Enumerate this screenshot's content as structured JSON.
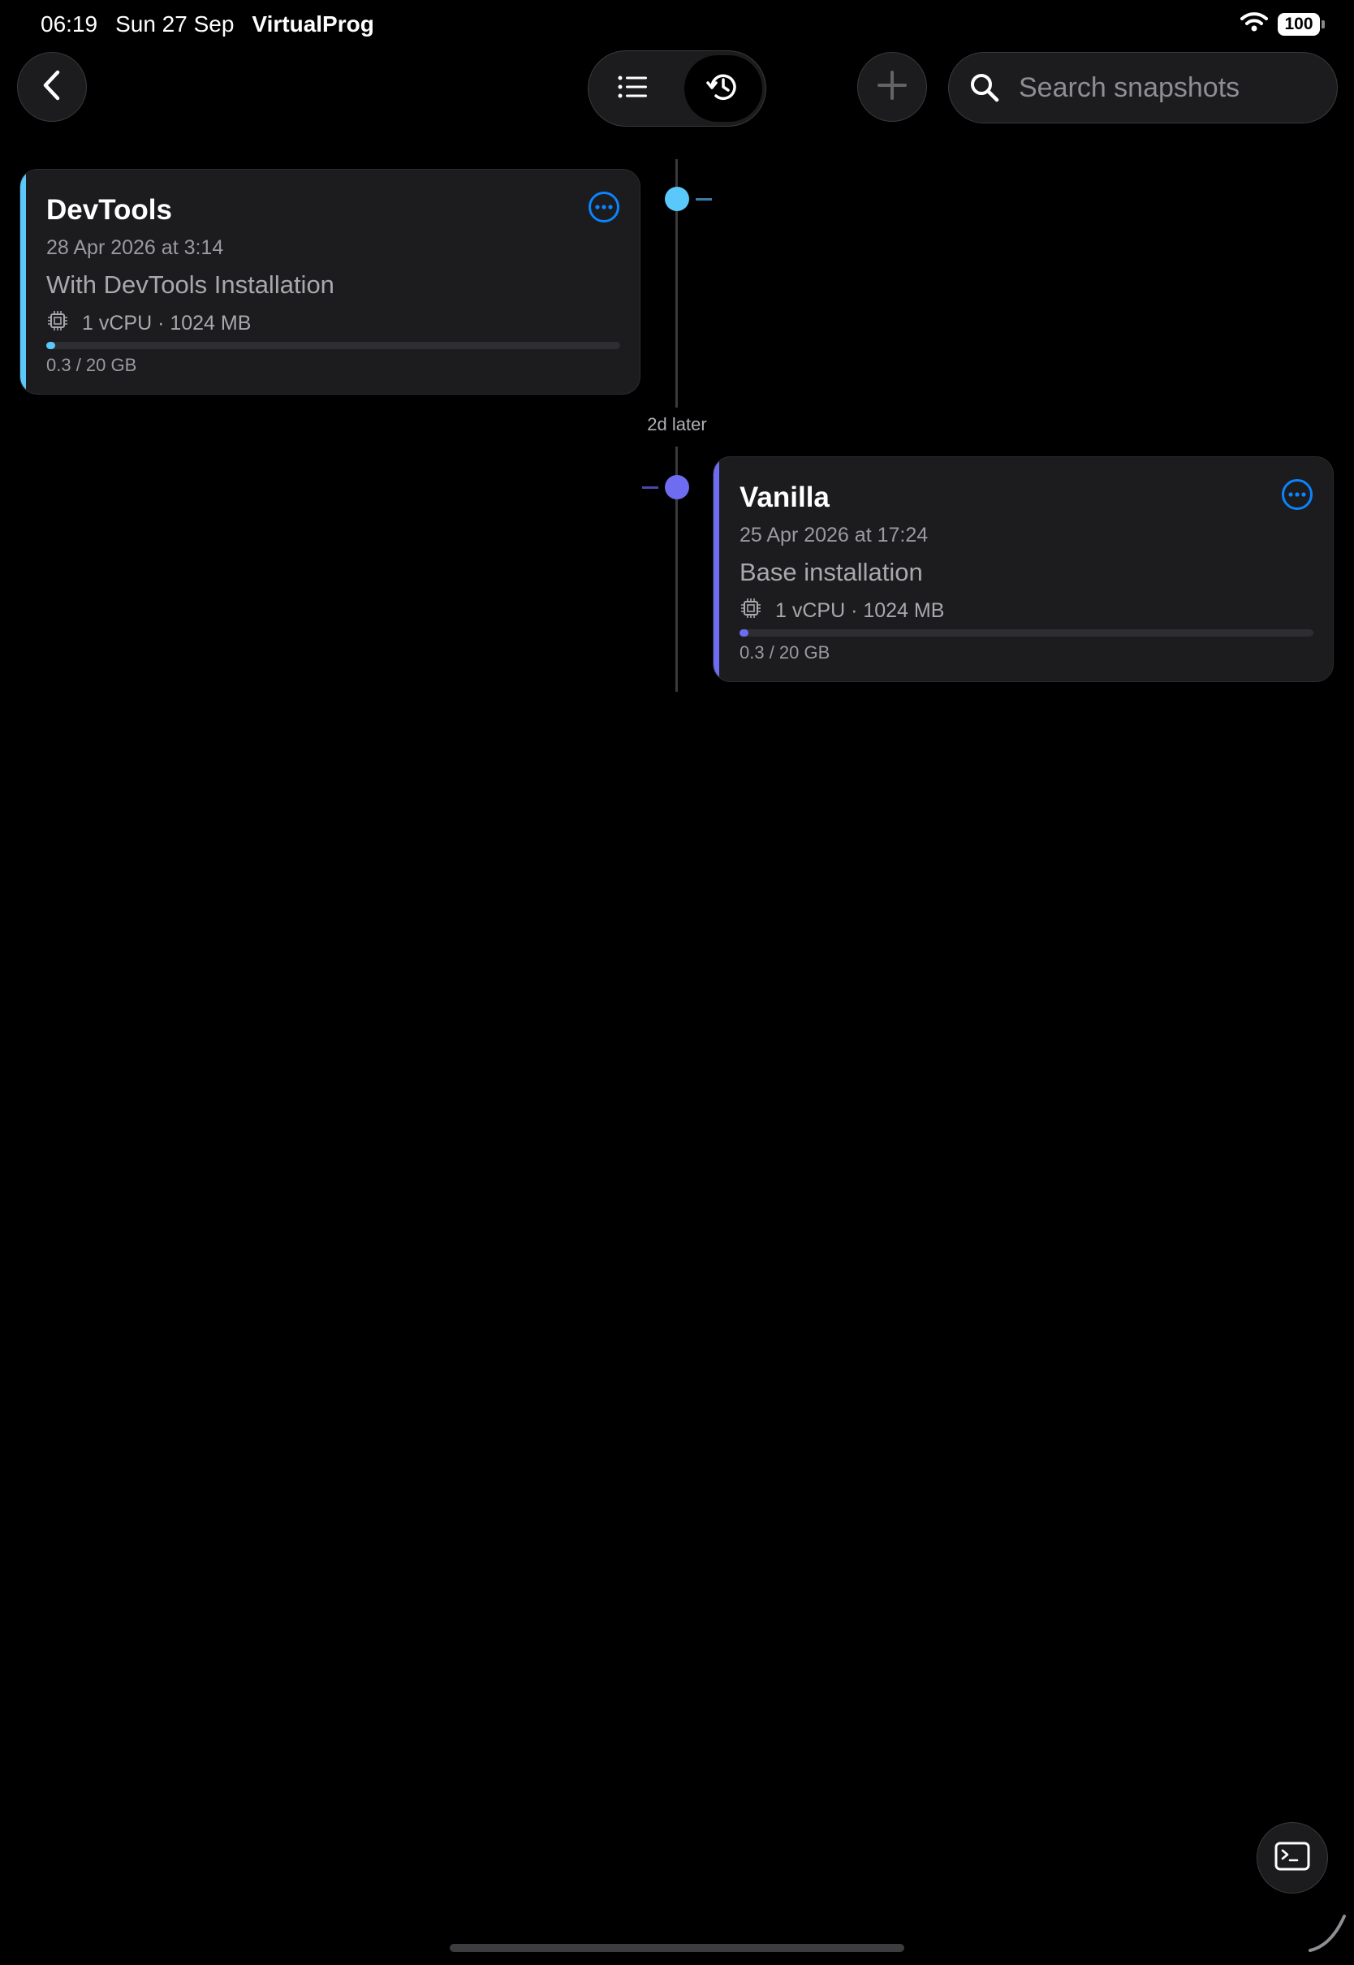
{
  "status_bar": {
    "time": "06:19",
    "date": "Sun 27 Sep",
    "app_name": "VirtualProg",
    "battery": "100"
  },
  "toolbar": {
    "back_icon": "chevron-left-icon",
    "view_modes": [
      {
        "name": "list",
        "icon": "list-icon",
        "selected": false
      },
      {
        "name": "timeline",
        "icon": "history-icon",
        "selected": true
      }
    ],
    "add_icon": "plus-icon",
    "search_placeholder": "Search snapshots",
    "search_value": ""
  },
  "timeline": {
    "gap_label": "2d later",
    "snapshots": [
      {
        "title": "DevTools",
        "date": "28 Apr 2026 at 3:14",
        "description": "With DevTools Installation",
        "specs": "1 vCPU · 1024 MB",
        "storage": "0.3 / 20 GB",
        "storage_fraction": 0.015,
        "accent_color": "#5ac8fa",
        "side": "left"
      },
      {
        "title": "Vanilla",
        "date": "25 Apr 2026 at 17:24",
        "description": "Base installation",
        "specs": "1 vCPU · 1024 MB",
        "storage": "0.3 / 20 GB",
        "storage_fraction": 0.015,
        "accent_color": "#6e6cf0",
        "side": "right"
      }
    ]
  },
  "colors": {
    "background": "#000000",
    "card": "#1c1c1e",
    "more_button": "#0a84ff"
  },
  "terminal_icon": "terminal-icon"
}
